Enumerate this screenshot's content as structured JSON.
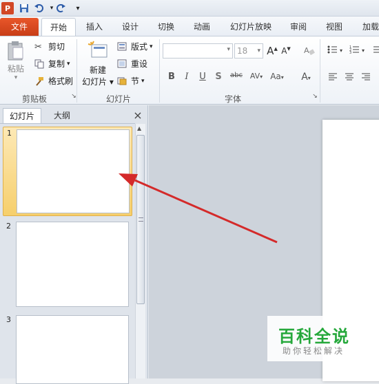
{
  "titlebar": {
    "app_icon": "P",
    "save_icon": "save-icon",
    "undo_icon": "undo-icon",
    "redo_icon": "redo-icon",
    "more_icon": "customize-icon"
  },
  "tabs": [
    "文件",
    "开始",
    "插入",
    "设计",
    "切换",
    "动画",
    "幻灯片放映",
    "审阅",
    "视图",
    "加载"
  ],
  "clipboard": {
    "paste": "粘贴",
    "cut": "剪切",
    "copy": "复制",
    "format_painter": "格式刷",
    "group": "剪贴板"
  },
  "slides_group": {
    "new_slide_1": "新建",
    "new_slide_2": "幻灯片",
    "layout": "版式",
    "reset": "重设",
    "section": "节",
    "group": "幻灯片"
  },
  "font": {
    "name_value": "",
    "size_value": "18",
    "grow": "A",
    "shrink": "A",
    "group": "字体",
    "bold": "B",
    "italic": "I",
    "underline": "U",
    "shadow": "S",
    "strike": "abc",
    "spacing": "AV",
    "case": "Aa",
    "color": "A"
  },
  "panel": {
    "tab_slides": "幻灯片",
    "tab_outline": "大纲",
    "close": "×"
  },
  "thumbnails": [
    "1",
    "2",
    "3"
  ],
  "watermark": {
    "title": "百科全说",
    "subtitle": "助你轻松解决"
  },
  "colors": {
    "accent": "#d24726",
    "arrow": "#d42a2a",
    "selected": "#f7c862"
  }
}
